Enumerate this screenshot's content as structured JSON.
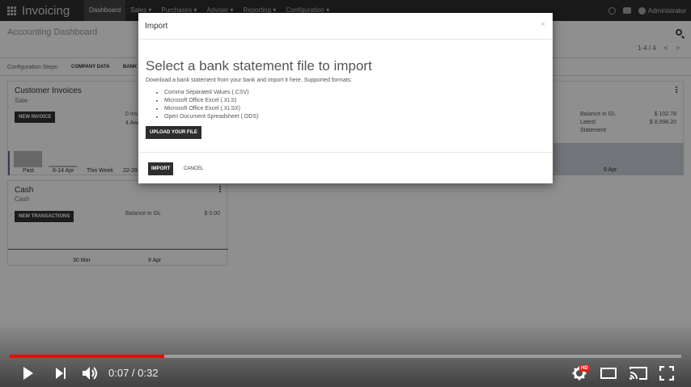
{
  "app": {
    "title": "Invoicing",
    "menu": [
      "Dashboard",
      "Sales ▾",
      "Purchases ▾",
      "Adviser ▾",
      "Reporting ▾",
      "Configuration ▾"
    ],
    "user": "Administrator"
  },
  "control_panel": {
    "title": "Accounting Dashboard",
    "pager": "1-4 / 4",
    "prev": "<",
    "next": ">"
  },
  "config_steps": {
    "label": "Configuration Steps:",
    "step1": "COMPANY DATA",
    "step2": "BANK"
  },
  "customer_card": {
    "title": "Customer Invoices",
    "subtitle": "Sale",
    "button": "NEW INVOICE",
    "stat1": "0 Inv",
    "stat2": "4 Awa",
    "bars": [
      "Past",
      "8-14 Apr",
      "This Week",
      "22-28"
    ]
  },
  "bank_card": {
    "label1": "Balance in GL",
    "value1": "$ 102.78",
    "label2": "Latest",
    "label2b": "Statement",
    "value2": "$ 8,998.20",
    "date": "9 Apr"
  },
  "cash_card": {
    "title": "Cash",
    "subtitle": "Cash",
    "button": "NEW TRANSACTIONS",
    "balance_label": "Balance in GL",
    "balance_value": "$ 0.00",
    "date1": "30 Mar",
    "date2": "9 Apr"
  },
  "modal": {
    "title": "Import",
    "close": "×",
    "heading": "Select a bank statement file to import",
    "description": "Download a bank statement from your bank and import it here. Supported formats:",
    "formats": [
      "Comma Separated Values (.CSV)",
      "Microsoft Office Excel (.XLS)",
      "Microsoft Office Excel (.XLSX)",
      "Open Document Spreadsheet (.ODS)"
    ],
    "upload_label": "UPLOAD YOUR FILE",
    "import_label": "IMPORT",
    "cancel_label": "CANCEL"
  },
  "player": {
    "time": "0:07 / 0:32",
    "progress": 0.23,
    "hd_label": "HD",
    "progress_color": "#ff0000"
  }
}
